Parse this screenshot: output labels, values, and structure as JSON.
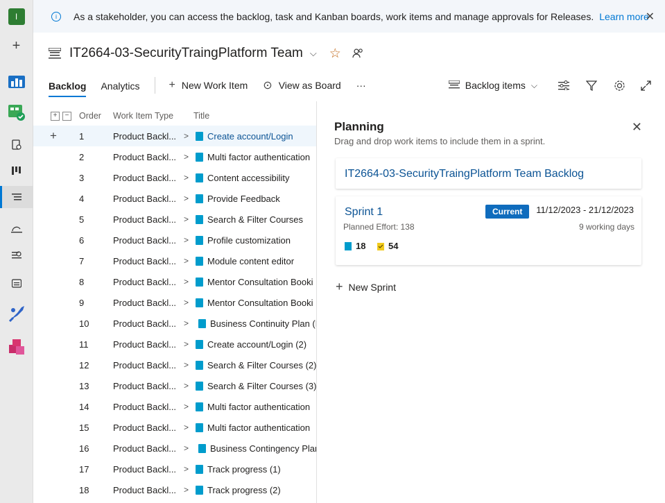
{
  "rail": {
    "avatar_letter": "I",
    "add_icon": "+"
  },
  "banner": {
    "message": "As a stakeholder, you can access the backlog, task and Kanban boards, work items and manage approvals for Releases.",
    "link": "Learn more",
    "close": "✕"
  },
  "team": {
    "title": "IT2664-03-SecurityTraingPlatform Team"
  },
  "toolbar": {
    "tab_backlog": "Backlog",
    "tab_analytics": "Analytics",
    "new_work_item": "New Work Item",
    "view_as_board": "View as Board",
    "more": "···",
    "backlog_level": "Backlog items"
  },
  "list": {
    "headers": {
      "order": "Order",
      "type": "Work Item Type",
      "title": "Title"
    },
    "rows": [
      {
        "order": "1",
        "type": "Product Backl...",
        "title": "Create account/Login"
      },
      {
        "order": "2",
        "type": "Product Backl...",
        "title": "Multi factor authentication"
      },
      {
        "order": "3",
        "type": "Product Backl...",
        "title": "Content accessibility"
      },
      {
        "order": "4",
        "type": "Product Backl...",
        "title": "Provide Feedback"
      },
      {
        "order": "5",
        "type": "Product Backl...",
        "title": "Search & Filter Courses"
      },
      {
        "order": "6",
        "type": "Product Backl...",
        "title": "Profile customization"
      },
      {
        "order": "7",
        "type": "Product Backl...",
        "title": "Module content editor"
      },
      {
        "order": "8",
        "type": "Product Backl...",
        "title": "Mentor Consultation Booki"
      },
      {
        "order": "9",
        "type": "Product Backl...",
        "title": "Mentor Consultation Booki"
      },
      {
        "order": "10",
        "type": "Product Backl...",
        "title": "Business Continuity Plan (E"
      },
      {
        "order": "11",
        "type": "Product Backl...",
        "title": "Create account/Login (2)"
      },
      {
        "order": "12",
        "type": "Product Backl...",
        "title": "Search & Filter Courses (2)"
      },
      {
        "order": "13",
        "type": "Product Backl...",
        "title": "Search & Filter Courses (3)"
      },
      {
        "order": "14",
        "type": "Product Backl...",
        "title": "Multi factor authentication"
      },
      {
        "order": "15",
        "type": "Product Backl...",
        "title": "Multi factor authentication"
      },
      {
        "order": "16",
        "type": "Product Backl...",
        "title": "Business Contingency Plar"
      },
      {
        "order": "17",
        "type": "Product Backl...",
        "title": "Track progress (1)"
      },
      {
        "order": "18",
        "type": "Product Backl...",
        "title": "Track progress (2)"
      }
    ]
  },
  "planning": {
    "title": "Planning",
    "subtitle": "Drag and drop work items to include them in a sprint.",
    "backlog_link": "IT2664-03-SecurityTraingPlatform Team Backlog",
    "sprint": {
      "name": "Sprint 1",
      "badge": "Current",
      "dates": "11/12/2023 - 21/12/2023",
      "effort": "Planned Effort: 138",
      "working_days": "9 working days",
      "backlog_count": "18",
      "task_count": "54"
    },
    "new_sprint": "New Sprint"
  },
  "colors": {
    "accent": "#0078d4",
    "backlog_icon": "#009ccc",
    "task_icon": "#f2cb1d",
    "badge": "#0f6cbd"
  }
}
